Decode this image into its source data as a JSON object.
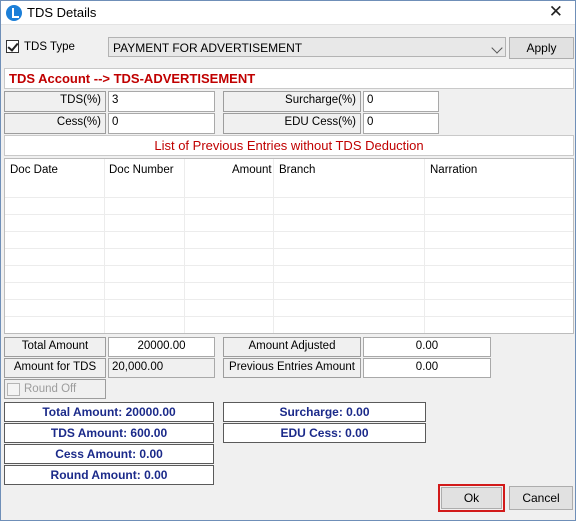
{
  "window": {
    "title": "TDS Details"
  },
  "tds_type": {
    "label": "TDS Type",
    "checked": true,
    "selected": "PAYMENT FOR ADVERTISEMENT",
    "apply_label": "Apply"
  },
  "account_header": "TDS Account --> TDS-ADVERTISEMENT",
  "rates": {
    "tds_label": "TDS(%)",
    "tds_value": "3",
    "cess_label": "Cess(%)",
    "cess_value": "0",
    "surcharge_label": "Surcharge(%)",
    "surcharge_value": "0",
    "edu_cess_label": "EDU Cess(%)",
    "edu_cess_value": "0"
  },
  "previous_entries": {
    "title": "List of Previous Entries without TDS Deduction",
    "columns": [
      "Doc Date",
      "Doc Number",
      "Amount",
      "Branch",
      "Narration"
    ]
  },
  "totals": {
    "total_amount_label": "Total Amount",
    "total_amount_value": "20000.00",
    "amount_for_tds_label": "Amount for TDS",
    "amount_for_tds_value": "20,000.00",
    "amount_adjusted_label": "Amount Adjusted",
    "amount_adjusted_value": "0.00",
    "previous_entries_amount_label": "Previous Entries Amount",
    "previous_entries_amount_value": "0.00",
    "round_off_label": "Round Off"
  },
  "summary": {
    "total_amount": "Total Amount: 20000.00",
    "tds_amount": "TDS Amount: 600.00",
    "cess_amount": "Cess Amount: 0.00",
    "round_amount": "Round Amount: 0.00",
    "surcharge": "Surcharge: 0.00",
    "edu_cess": "EDU Cess: 0.00"
  },
  "buttons": {
    "ok": "Ok",
    "cancel": "Cancel"
  },
  "colors": {
    "header_red": "#c00000",
    "summary_blue": "#1b2a8a",
    "focus_red": "#d21a1a"
  }
}
